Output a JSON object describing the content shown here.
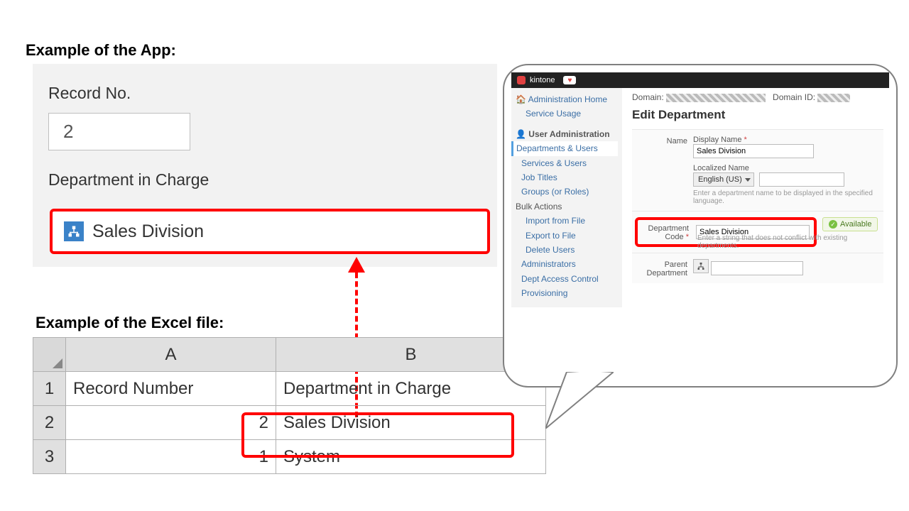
{
  "captions": {
    "app": "Example of the App:",
    "excel": "Example of the Excel file:"
  },
  "app": {
    "record_label": "Record No.",
    "record_value": "2",
    "dept_label": "Department in Charge",
    "dept_value": "Sales Division"
  },
  "excel": {
    "cols": {
      "a": "A",
      "b": "B"
    },
    "header": {
      "a": "Record Number",
      "b": "Department in Charge"
    },
    "rows": [
      {
        "n": "1"
      },
      {
        "n": "2",
        "a": "2",
        "b": "Sales Division"
      },
      {
        "n": "3",
        "a": "1",
        "b": "System"
      }
    ]
  },
  "admin": {
    "brand": "kintone",
    "side": {
      "administration_home": "Administration Home",
      "service_usage": "Service Usage",
      "user_admin_hdr": "User Administration",
      "departments_users": "Departments & Users",
      "services_users": "Services & Users",
      "job_titles": "Job Titles",
      "groups": "Groups (or Roles)",
      "bulk_hdr": "Bulk Actions",
      "import": "Import from File",
      "export": "Export to File",
      "delete_users": "Delete Users",
      "administrators": "Administrators",
      "dept_access": "Dept Access Control",
      "provisioning": "Provisioning"
    },
    "domain_label": "Domain:",
    "domain_id_label": "Domain ID:",
    "title": "Edit Department",
    "name_label": "Name",
    "display_name_label": "Display Name",
    "display_name_value": "Sales Division",
    "localized_label": "Localized Name",
    "lang_select": "English (US)",
    "lang_hint": "Enter a department name to be displayed in the specified language.",
    "dept_code_label": "Department Code",
    "dept_code_value": "Sales Division",
    "dept_code_hint": "Enter a string that does not conflict with existing departments.",
    "available": "Available",
    "parent_label": "Parent Department"
  }
}
